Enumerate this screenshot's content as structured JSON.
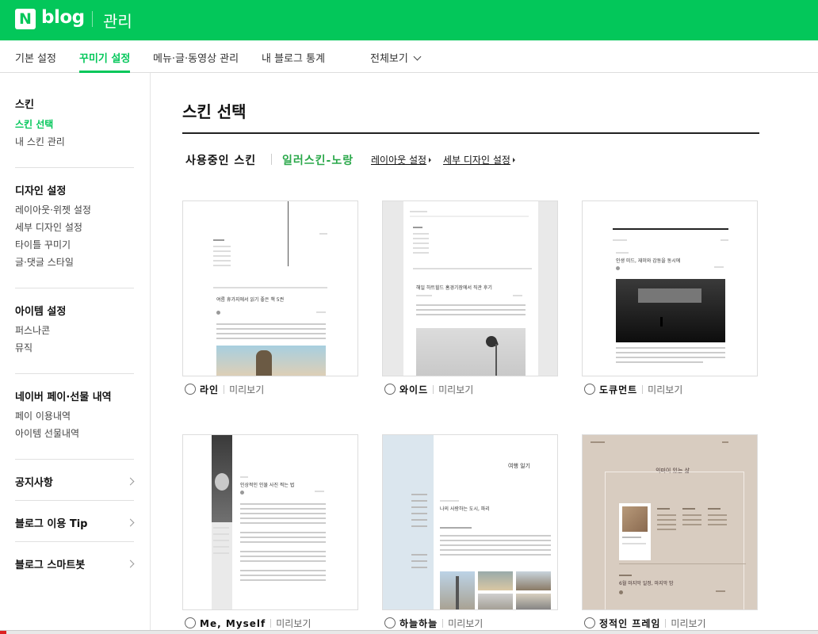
{
  "header": {
    "logo_letter": "N",
    "logo_text": "blog",
    "section": "관리"
  },
  "menu": {
    "items": [
      "기본 설정",
      "꾸미기 설정",
      "메뉴·글·동영상 관리",
      "내 블로그 통계",
      "전체보기"
    ],
    "active_index": 1
  },
  "sidebar": {
    "groups": [
      {
        "title": "스킨",
        "items": [
          "스킨 선택",
          "내 스킨 관리"
        ]
      },
      {
        "title": "디자인 설정",
        "items": [
          "레이아웃·위젯 설정",
          "세부 디자인 설정",
          "타이틀 꾸미기",
          "글·댓글 스타일"
        ]
      },
      {
        "title": "아이템 설정",
        "items": [
          "퍼스나콘",
          "뮤직"
        ]
      },
      {
        "title": "네이버 페이·선물 내역",
        "items": [
          "페이 이용내역",
          "아이템 선물내역"
        ]
      }
    ],
    "links": [
      "공지사항",
      "블로그 이용 Tip",
      "블로그 스마트봇"
    ],
    "active_item": "스킨 선택"
  },
  "main": {
    "title": "스킨 선택",
    "current_label": "사용중인 스킨",
    "current_skin": "일러스킨-노랑",
    "links": [
      "레이아웃 설정",
      "세부 디자인 설정"
    ],
    "preview_label": "미리보기",
    "skins": [
      {
        "name": "라인",
        "thumb_title": "여름 휴가지에서 읽기 좋은 책 5권"
      },
      {
        "name": "와이드",
        "thumb_title": "해일 하트힐드 홈경기장에서 직관 후기"
      },
      {
        "name": "도큐먼트",
        "thumb_title": "인생 미드, 재미와 감동을 동시에"
      },
      {
        "name": "Me, Myself",
        "thumb_title": "인상적인 인물 사진 찍는 법"
      },
      {
        "name": "하늘하늘",
        "thumb_title": "나의 사랑하는 도시, 파리",
        "thumb_heading": "여행 일기"
      },
      {
        "name": "정적인 프레임",
        "thumb_title": "6월 마지막 일정, 마지막 밤",
        "thumb_heading": "의미이 있는 삶"
      }
    ]
  },
  "colors": {
    "brand": "#03c75a",
    "current_skin": "#2aa84a"
  }
}
